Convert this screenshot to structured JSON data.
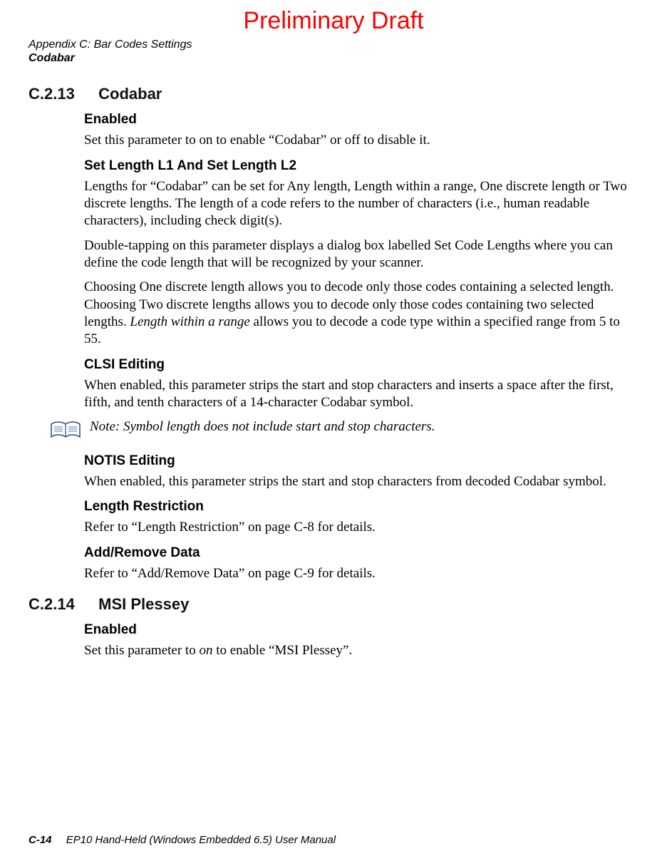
{
  "watermark": "Preliminary Draft",
  "header": {
    "appendix_line": "Appendix C: Bar Codes Settings",
    "topic": "Codabar"
  },
  "section_c213": {
    "number": "C.2.13",
    "title": "Codabar",
    "enabled": {
      "heading": "Enabled",
      "body": "Set this parameter to on to enable “Codabar” or off to disable it."
    },
    "set_length": {
      "heading": "Set Length L1 And Set Length L2",
      "p1": "Lengths for “Codabar” can be set for Any length, Length within a range, One discrete length or Two discrete lengths. The length of a code refers to the number of characters (i.e., human readable characters), including check digit(s).",
      "p2": "Double-tapping on this parameter displays a dialog box labelled Set Code Lengths where you can define the code length that will be recognized by your scanner.",
      "p3_pre": "Choosing One discrete length allows you to decode only those codes containing a selected length. Choosing Two discrete lengths allows you to decode only those codes containing two selected lengths. ",
      "p3_em": "Length within a range",
      "p3_post": " allows you to decode a code type within a specified range from 5 to 55."
    },
    "clsi": {
      "heading": "CLSI Editing",
      "body": "When enabled, this parameter strips the start and stop characters and inserts a space after the first, fifth, and tenth characters of a 14-character Codabar symbol."
    },
    "note": {
      "label": "Note:",
      "body": "Symbol length does not include start and stop characters."
    },
    "notis": {
      "heading": "NOTIS Editing",
      "body": "When enabled, this parameter strips the start and stop characters from decoded Codabar symbol."
    },
    "length_restriction": {
      "heading": "Length Restriction",
      "body": "Refer to “Length Restriction” on page C-8 for details."
    },
    "add_remove": {
      "heading": "Add/Remove Data",
      "body": "Refer to “Add/Remove Data” on page C-9 for details."
    }
  },
  "section_c214": {
    "number": "C.2.14",
    "title": "MSI Plessey",
    "enabled": {
      "heading": "Enabled",
      "body_pre": "Set this parameter to ",
      "body_em": "on",
      "body_post": " to enable “MSI Plessey”."
    }
  },
  "footer": {
    "page_no": "C-14",
    "manual": "EP10 Hand-Held (Windows Embedded 6.5) User Manual"
  }
}
